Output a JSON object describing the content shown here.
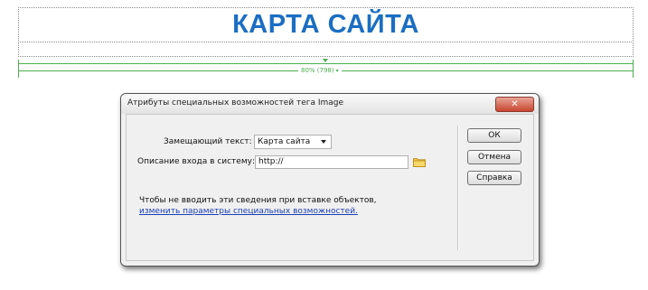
{
  "design": {
    "heading": "КАРТА САЙТА",
    "ruler_label": "80% (798)",
    "ruler_caret_icon": "chevron-down-icon"
  },
  "dialog": {
    "title": "Атрибуты специальных возможностей тега Image",
    "close_icon": "close-icon",
    "alt_text_label": "Замещающий текст:",
    "alt_text_value": "Карта сайта",
    "long_desc_label": "Описание входа в систему:",
    "long_desc_value": "http://",
    "folder_icon": "folder-icon",
    "note_text": "Чтобы не вводить эти сведения при вставке объектов, ",
    "note_link": "изменить параметры специальных возможностей.",
    "buttons": {
      "ok": "ОК",
      "cancel": "Отмена",
      "help": "Справка"
    }
  },
  "colors": {
    "heading": "#1b6ec2",
    "ruler": "#4caf50",
    "close_button": "#c8452f",
    "link": "#1a3fb5"
  }
}
